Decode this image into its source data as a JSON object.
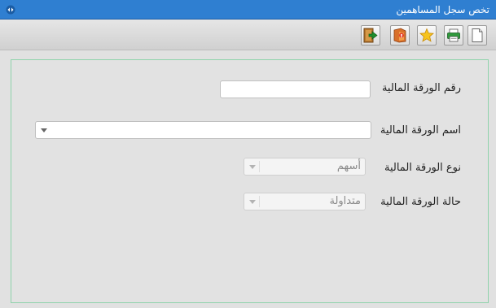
{
  "window": {
    "title": "تخص سجل المساهمين"
  },
  "toolbar": {
    "buttons": [
      {
        "name": "exit",
        "icon": "exit-door-icon"
      },
      {
        "name": "help",
        "icon": "help-book-icon"
      },
      {
        "name": "favorite",
        "icon": "star-icon"
      },
      {
        "name": "print",
        "icon": "printer-icon"
      },
      {
        "name": "new",
        "icon": "new-document-icon"
      }
    ]
  },
  "form": {
    "security_number": {
      "label": "رقم الورقة المالية",
      "value": ""
    },
    "security_name": {
      "label": "اسم الورقة المالية",
      "value": ""
    },
    "security_type": {
      "label": "نوع الورقة المالية",
      "value": "أسهم"
    },
    "security_status": {
      "label": "حالة الورقة المالية",
      "value": "متداولة"
    }
  },
  "colors": {
    "titlebar": "#2f7fd1",
    "panel_border": "#8fd3ab",
    "background": "#e1e1e1"
  }
}
